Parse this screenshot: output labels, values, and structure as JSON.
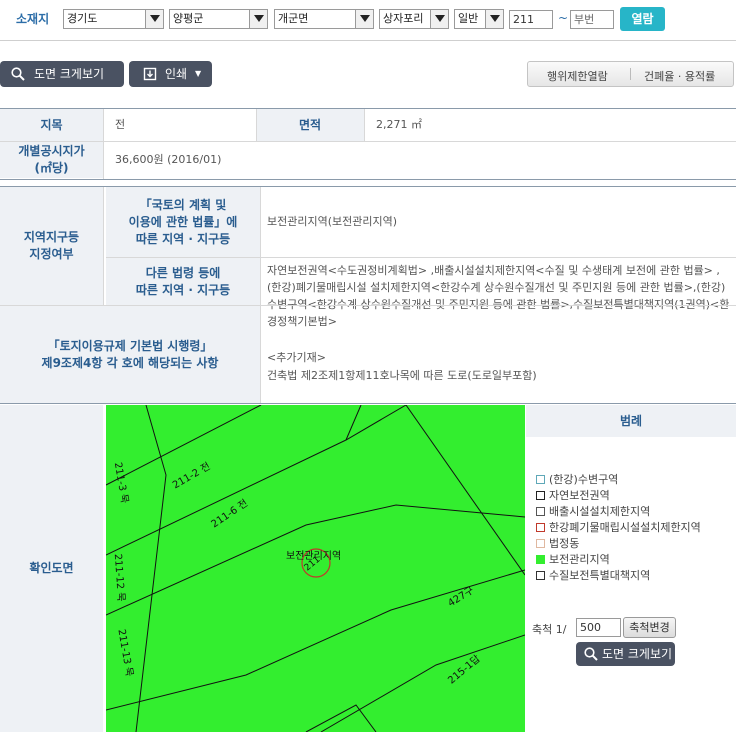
{
  "search": {
    "label": "소재지",
    "province": "경기도",
    "county": "양평군",
    "town": "개군면",
    "village": "상자포리",
    "lot_type": "일반",
    "main_number": "211",
    "dash": "~",
    "sub_number_placeholder": "부번",
    "submit_label": "열람"
  },
  "toolbar": {
    "map_zoom_label": "도면 크게보기",
    "print_label": "인쇄",
    "restriction_label": "행위제한열람",
    "coverage_label": "건폐율 · 용적률"
  },
  "land_info": {
    "category_header": "지목",
    "category_value": "전",
    "area_header": "면적",
    "area_value": "2,271 ㎡",
    "price_header_line1": "개별공시지가",
    "price_header_line2": "(㎡당)",
    "price_value": "36,600원 (2016/01)"
  },
  "zoning": {
    "main_header_line1": "지역지구등",
    "main_header_line2": "지정여부",
    "planning_law_header_line1": "「국토의 계획 및",
    "planning_law_header_line2": "이용에 관한 법률」에",
    "planning_law_header_line3": "따른 지역 · 지구등",
    "planning_law_value": "보전관리지역(보전관리지역)",
    "other_law_header_line1": "다른 법령 등에",
    "other_law_header_line2": "따른 지역 · 지구등",
    "other_law_value": "자연보전권역<수도권정비계획법> ,배출시설설치제한지역<수질 및 수생태계 보전에 관한 법률> ,(한강)폐기물매립시설 설치제한지역<한강수계 상수원수질개선 및 주민지원 등에 관한 법률>,(한강)수변구역<한강수계 상수원수질개선 및 주민지원 등에 관한 법률>,수질보전특별대책지역(1권역)<환경정책기본법>",
    "decree_header_line1": "「토지이용규제 기본법 시행령」",
    "decree_header_line2": "제9조제4항 각 호에 해당되는 사항",
    "decree_value_line1": "<추가기재>",
    "decree_value_line2": "건축법 제2조제1항제11호나목에 따른 도로(도로일부포함)"
  },
  "map_section": {
    "header": "확인도면",
    "parcel_labels": {
      "p2": "211-2 전",
      "p3": "211-3 묵",
      "p6": "211-6 전",
      "p12": "211-12 묵",
      "p13": "211-13 묵",
      "p427": "427구",
      "p2151": "215-1답",
      "zone_label": "보전관리지역",
      "sel_label": "211"
    }
  },
  "legend": {
    "title": "범례",
    "items": [
      {
        "label": "(한강)수변구역",
        "color": "#5fa8b8"
      },
      {
        "label": "자연보전권역",
        "color": "#222222"
      },
      {
        "label": "배출시설설치제한지역",
        "color": "#555555"
      },
      {
        "label": "한강폐기물매립시설설치제한지역",
        "color": "#c0392b"
      },
      {
        "label": "법정동",
        "color": "#e0b8a0"
      },
      {
        "label": "보전관리지역",
        "color": "#33ee2f"
      },
      {
        "label": "수질보전특별대책지역",
        "color": "#333333"
      }
    ],
    "scale_label": "축척 1/",
    "scale_value": "500",
    "scale_change_label": "축척변경",
    "map_zoom_label": "도면 크게보기"
  }
}
